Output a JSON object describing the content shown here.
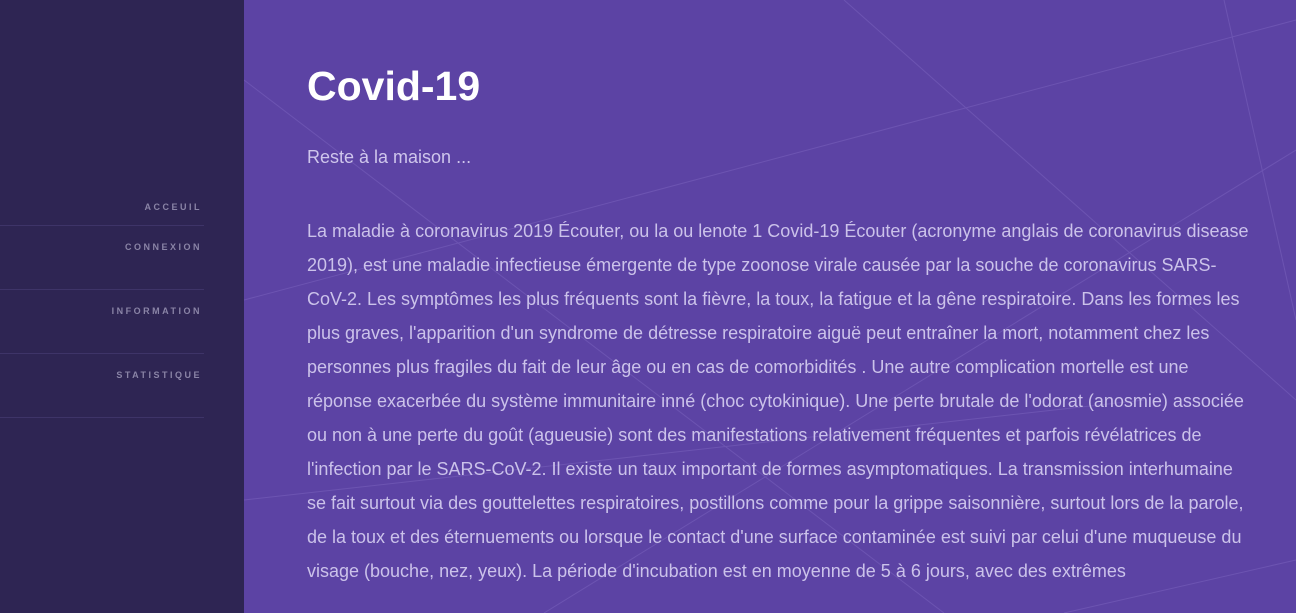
{
  "nav": {
    "items": [
      {
        "label": "ACCEUIL"
      },
      {
        "label": "CONNEXION"
      },
      {
        "label": "INFORMATION"
      },
      {
        "label": "STATISTIQUE"
      }
    ]
  },
  "main": {
    "title": "Covid-19",
    "subtitle": "Reste à la maison ...",
    "body": "La maladie à coronavirus 2019 Écouter, ou la ou lenote 1 Covid-19 Écouter (acronyme anglais de coronavirus disease 2019), est une maladie infectieuse émergente de type zoonose virale causée par la souche de coronavirus SARS-CoV-2. Les symptômes les plus fréquents sont la fièvre, la toux, la fatigue et la gêne respiratoire. Dans les formes les plus graves, l'apparition d'un syndrome de détresse respiratoire aiguë peut entraîner la mort, notamment chez les personnes plus fragiles du fait de leur âge ou en cas de comorbidités . Une autre complication mortelle est une réponse exacerbée du système immunitaire inné (choc cytokinique). Une perte brutale de l'odorat (anosmie) associée ou non à une perte du goût (agueusie) sont des manifestations relativement fréquentes et parfois révélatrices de l'infection par le SARS-CoV-2. Il existe un taux important de formes asymptomatiques. La transmission interhumaine se fait surtout via des gouttelettes respiratoires, postillons comme pour la grippe saisonnière, surtout lors de la parole, de la toux et des éternuements ou lorsque le contact d'une surface contaminée est suivi par celui d'une muqueuse du visage (bouche, nez, yeux). La période d'incubation est en moyenne de 5 à 6 jours, avec des extrêmes"
  },
  "colors": {
    "sidebar_bg": "#2e2553",
    "main_bg": "#5c43a4",
    "title": "#ffffff",
    "text": "#cbc2ea",
    "nav_text": "#8a84a6"
  }
}
